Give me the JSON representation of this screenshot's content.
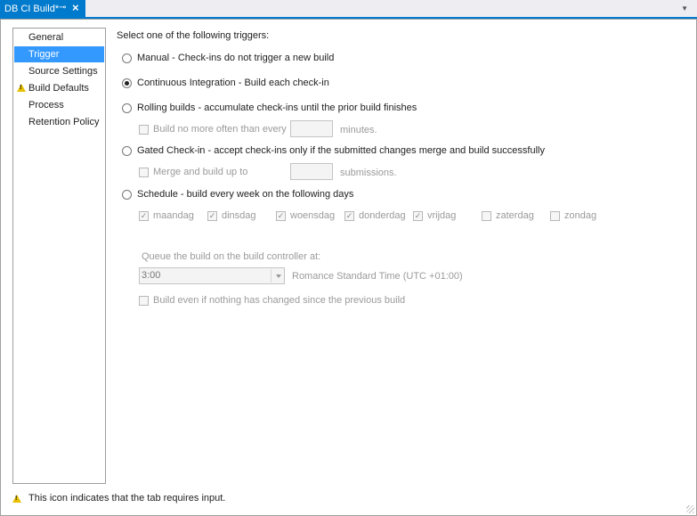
{
  "tab": {
    "title": "DB CI Build*",
    "pin_icon": "pin-icon",
    "close_icon": "close-icon"
  },
  "sidebar": {
    "items": [
      {
        "label": "General",
        "selected": false,
        "warning": false
      },
      {
        "label": "Trigger",
        "selected": true,
        "warning": false
      },
      {
        "label": "Source Settings",
        "selected": false,
        "warning": false
      },
      {
        "label": "Build Defaults",
        "selected": false,
        "warning": true
      },
      {
        "label": "Process",
        "selected": false,
        "warning": false
      },
      {
        "label": "Retention Policy",
        "selected": false,
        "warning": false
      }
    ]
  },
  "trigger": {
    "heading": "Select one of the following triggers:",
    "options": {
      "manual": "Manual - Check-ins do not trigger a new build",
      "ci": "Continuous Integration - Build each check-in",
      "rolling": "Rolling builds - accumulate check-ins until the prior build finishes",
      "gated": "Gated Check-in - accept check-ins only if the submitted changes merge and build successfully",
      "schedule": "Schedule - build every week on the following days"
    },
    "selected_option": "ci",
    "rolling_sub": {
      "label": "Build no more often than every",
      "value": "",
      "unit": "minutes."
    },
    "gated_sub": {
      "label": "Merge and build up to",
      "value": "",
      "unit": "submissions."
    },
    "days": [
      {
        "label": "maandag",
        "checked": true
      },
      {
        "label": "dinsdag",
        "checked": true
      },
      {
        "label": "woensdag",
        "checked": true
      },
      {
        "label": "donderdag",
        "checked": true
      },
      {
        "label": "vrijdag",
        "checked": true
      },
      {
        "label": "zaterdag",
        "checked": false
      },
      {
        "label": "zondag",
        "checked": false
      }
    ],
    "queue_label": "Queue the build on the build controller at:",
    "time_value": "3:00",
    "timezone": "Romance Standard Time (UTC +01:00)",
    "build_even": "Build even if nothing has changed since the previous build"
  },
  "footer": {
    "text": "This icon indicates that the tab requires input."
  },
  "colors": {
    "accent": "#007acc",
    "selection": "#3399ff",
    "warning": "#e8c000"
  }
}
